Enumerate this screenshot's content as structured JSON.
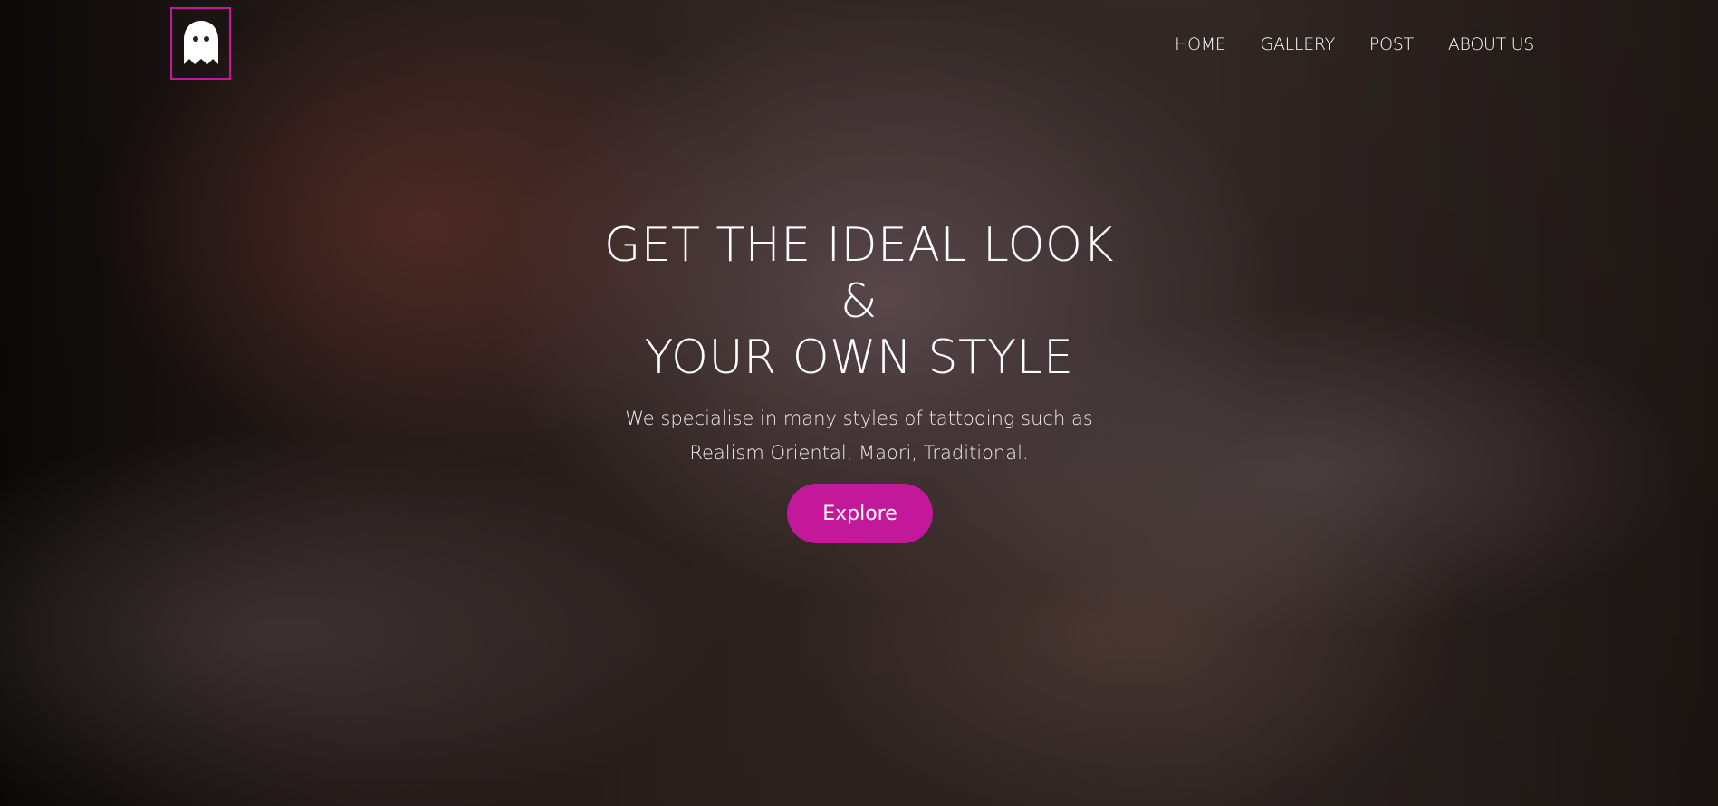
{
  "header": {
    "logo_icon": "ghost-icon",
    "accent_color": "#c4189a"
  },
  "nav": {
    "items": [
      {
        "label": "HOME"
      },
      {
        "label": "GALLERY"
      },
      {
        "label": "POST"
      },
      {
        "label": "ABOUT US"
      }
    ]
  },
  "hero": {
    "headline_line1": "GET THE IDEAL LOOK",
    "headline_line2": "&",
    "headline_line3": "YOUR OWN STYLE",
    "subtitle_line1": "We specialise in many styles of tattooing such as",
    "subtitle_line2": "Realism Oriental, Maori, Traditional.",
    "cta_label": "Explore",
    "cta_color": "#c4189a"
  }
}
